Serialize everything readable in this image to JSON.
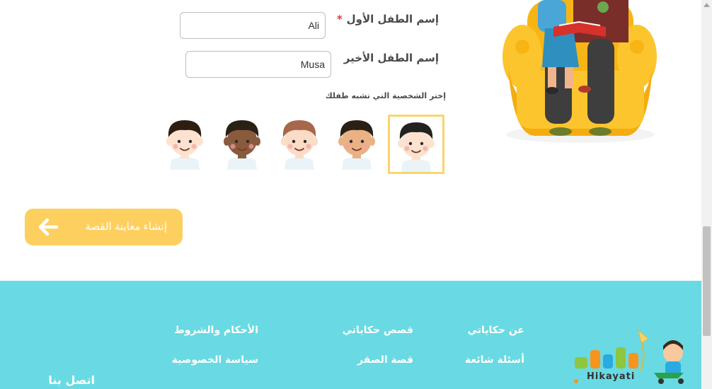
{
  "form": {
    "first_name_label": "إسم الطفل الأول",
    "required_mark": "*",
    "first_name_value": "Ali",
    "last_name_label": "إسم الطفل الأخير",
    "last_name_value": "Musa",
    "character_label": "إختر الشخصية التي تشبه طفلك",
    "avatars": [
      {
        "skin": "#fde3cf",
        "hair": "#222222",
        "selected": true
      },
      {
        "skin": "#e9b184",
        "hair": "#2a2016",
        "selected": false
      },
      {
        "skin": "#fbdcc6",
        "hair": "#a8664a",
        "selected": false
      },
      {
        "skin": "#8a5a3c",
        "hair": "#2a2016",
        "selected": false
      },
      {
        "skin": "#fde3cf",
        "hair": "#2e1e12",
        "selected": false
      }
    ]
  },
  "cta": {
    "label": "إنشاء معاينة القصة"
  },
  "footer": {
    "col_about": [
      "عن حكاياتي",
      "أسئلة شائعة"
    ],
    "col_stories": [
      "قصص حكاياتي",
      "قصة الصقر"
    ],
    "col_legal": [
      "الأحكام والشروط",
      "سياسة الخصوصية"
    ],
    "contact": "اتصل بنا",
    "logo_text": "Hikayati"
  },
  "colors": {
    "footer_bg": "#69dae3",
    "cta_bg": "#fdcf5f",
    "selected_border": "#fbd46a",
    "required": "#e53935"
  }
}
